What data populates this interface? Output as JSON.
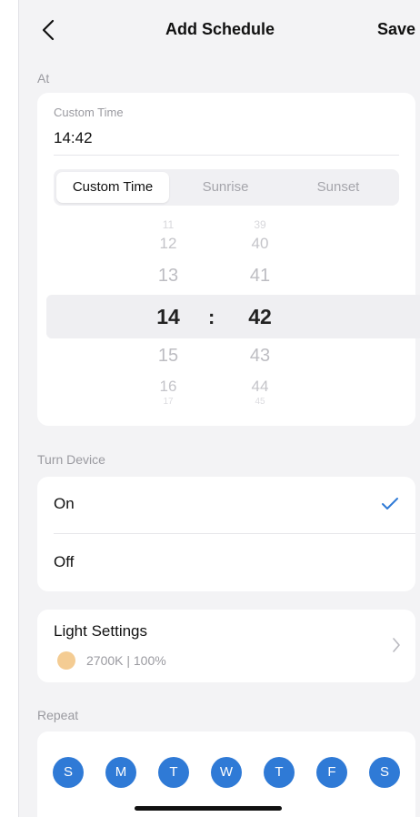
{
  "header": {
    "title": "Add Schedule",
    "save_label": "Save"
  },
  "at": {
    "section_label": "At",
    "custom_time_label": "Custom Time",
    "custom_time_value": "14:42",
    "segments": [
      "Custom Time",
      "Sunrise",
      "Sunset"
    ],
    "active_segment": "Custom Time",
    "picker": {
      "hours": [
        "11",
        "12",
        "13",
        "14",
        "15",
        "16",
        "17"
      ],
      "minutes": [
        "39",
        "40",
        "41",
        "42",
        "43",
        "44",
        "45"
      ],
      "selected_hour": "14",
      "selected_minute": "42",
      "separator": ":"
    }
  },
  "turn_device": {
    "section_label": "Turn Device",
    "options": [
      "On",
      "Off"
    ],
    "selected": "On"
  },
  "light_settings": {
    "title": "Light Settings",
    "summary": "2700K | 100%",
    "swatch_color": "#f4cc93"
  },
  "repeat": {
    "section_label": "Repeat",
    "days": [
      "S",
      "M",
      "T",
      "W",
      "T",
      "F",
      "S"
    ],
    "active_color": "#2f7ad6"
  },
  "colors": {
    "accent": "#2f7ad6",
    "background": "#f3f3f5"
  }
}
